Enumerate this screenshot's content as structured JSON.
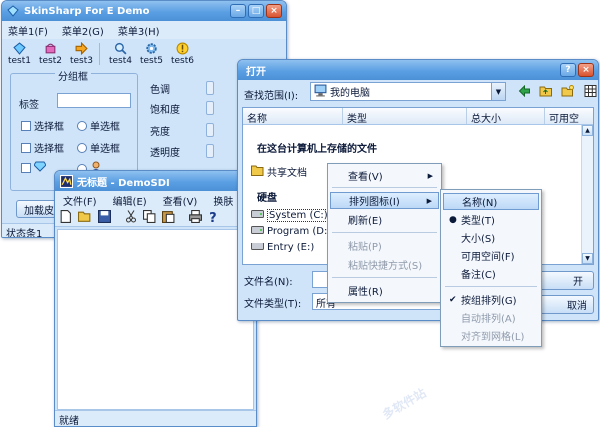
{
  "main_window": {
    "title": "SkinSharp For E Demo",
    "menu": [
      "菜单1(F)",
      "菜单2(G)",
      "菜单3(H)"
    ],
    "toolbar": [
      {
        "label": "test1",
        "icon": "diamond-icon"
      },
      {
        "label": "test2",
        "icon": "basket-icon"
      },
      {
        "label": "test3",
        "icon": "arrow-right-icon"
      },
      {
        "label": "test4",
        "icon": "magnifier-icon"
      },
      {
        "label": "test5",
        "icon": "gear-icon"
      },
      {
        "label": "test6",
        "icon": "warning-icon"
      }
    ],
    "group_title": "分组框",
    "field_label": "标签",
    "checkbox_label": "选择框",
    "radio_label": "单选框",
    "slider_labels": [
      "色调",
      "饱和度",
      "亮度",
      "透明度"
    ],
    "load_button": "加载皮",
    "status": "状态条1"
  },
  "sdi_window": {
    "title": "无标题 - DemoSDI",
    "menu": [
      "文件(F)",
      "编辑(E)",
      "查看(V)",
      "换肤"
    ],
    "status": "就绪"
  },
  "open_dialog": {
    "title": "打开",
    "lookin_label": "查找范围(I):",
    "lookin_value": "我的电脑",
    "columns": [
      "名称",
      "类型",
      "总大小",
      "可用空"
    ],
    "section_files": "在这台计算机上存储的文件",
    "shared_docs": "共享文档",
    "section_disks": "硬盘",
    "drives": [
      "System (C:)",
      "Program (D:)",
      "Entry (E:)"
    ],
    "filename_label": "文件名(N):",
    "filetype_label": "文件类型(T):",
    "filetype_value": "所有",
    "open_button": "开",
    "cancel_button": "取消"
  },
  "context_menu": [
    "查看(V)",
    "排列图标(I)",
    "刷新(E)",
    "粘贴(P)",
    "粘贴快捷方式(S)",
    "属性(R)"
  ],
  "submenu": [
    "名称(N)",
    "类型(T)",
    "大小(S)",
    "可用空间(F)",
    "备注(C)",
    "按组排列(G)",
    "自动排列(A)",
    "对齐到网格(L)"
  ],
  "watermark": "多软件站"
}
